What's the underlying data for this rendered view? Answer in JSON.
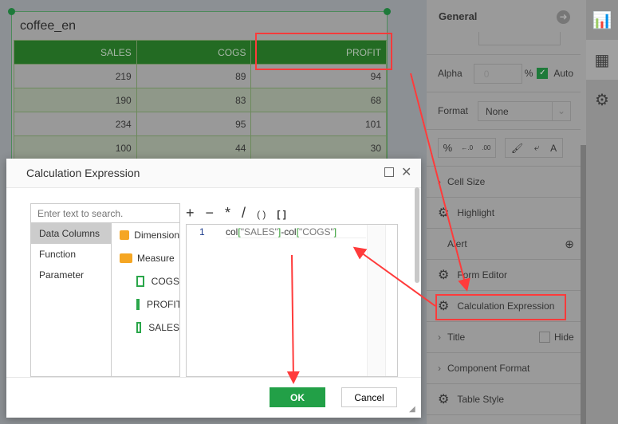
{
  "widget": {
    "title": "coffee_en",
    "columns": [
      "SALES",
      "COGS",
      "PROFIT"
    ],
    "rows": [
      [
        "219",
        "89",
        "94"
      ],
      [
        "190",
        "83",
        "68"
      ],
      [
        "234",
        "95",
        "101"
      ],
      [
        "100",
        "44",
        "30"
      ]
    ]
  },
  "panel": {
    "section": "General",
    "alpha_label": "Alpha",
    "alpha_value": "0",
    "percent": "%",
    "auto_label": "Auto",
    "format_label": "Format",
    "format_value": "None",
    "items": {
      "cell_size": "Cell Size",
      "highlight": "Highlight",
      "alert": "Alert",
      "form_editor": "Form Editor",
      "calc_expr": "Calculation Expression",
      "title": "Title",
      "hide": "Hide",
      "component_format": "Component Format",
      "table_style": "Table Style"
    }
  },
  "dialog": {
    "title": "Calculation Expression",
    "search_placeholder": "Enter text to search.",
    "tabs": [
      "Data Columns",
      "Function",
      "Parameter"
    ],
    "tree": {
      "dimension": "Dimension",
      "measure": "Measure",
      "fields": [
        "COGS",
        "PROFIT",
        "SALES"
      ]
    },
    "operators": [
      "+",
      "−",
      "*",
      "/",
      "( )",
      "[ ]"
    ],
    "line_number": "1",
    "code": {
      "p1": "col",
      "p2": "[",
      "p3": "\"SALES\"",
      "p4": "]",
      "p5": "-col",
      "p6": "[",
      "p7": "\"COGS\"",
      "p8": "]"
    },
    "ok": "OK",
    "cancel": "Cancel"
  },
  "colors": {
    "accent": "#22a047",
    "header": "#236b23",
    "annotation": "#ff3b3b"
  }
}
